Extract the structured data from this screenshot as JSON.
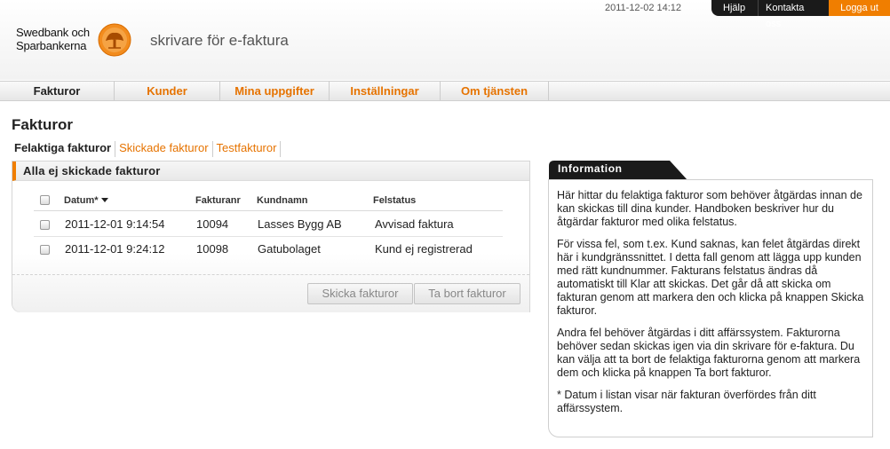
{
  "header": {
    "brand_line1": "Swedbank och",
    "brand_line2": "Sparbankerna",
    "app_title": "skrivare för e-faktura",
    "datetime": "2011-12-02 14:12",
    "links": {
      "help": "Hjälp",
      "contact": "Kontakta oss",
      "logout": "Logga ut"
    }
  },
  "nav": {
    "items": [
      {
        "label": "Fakturor",
        "active": true
      },
      {
        "label": "Kunder"
      },
      {
        "label": "Mina uppgifter"
      },
      {
        "label": "Inställningar"
      },
      {
        "label": "Om tjänsten"
      }
    ]
  },
  "page": {
    "title": "Fakturor",
    "subtabs": [
      "Felaktiga fakturor",
      "Skickade fakturor",
      "Testfakturor"
    ]
  },
  "invoices": {
    "panel_title": "Alla ej skickade fakturor",
    "columns": {
      "date": "Datum*",
      "number": "Fakturanr",
      "customer": "Kundnamn",
      "status": "Felstatus"
    },
    "rows": [
      {
        "date": "2011-12-01 9:14:54",
        "number": "10094",
        "customer": "Lasses Bygg AB",
        "status": "Avvisad faktura"
      },
      {
        "date": "2011-12-01 9:24:12",
        "number": "10098",
        "customer": "Gatubolaget",
        "status": "Kund ej registrerad"
      }
    ],
    "buttons": {
      "send": "Skicka fakturor",
      "delete": "Ta bort fakturor"
    }
  },
  "info": {
    "title": "Information",
    "paragraphs": [
      "Här hittar du felaktiga fakturor som behöver åtgärdas innan de kan skickas till dina kunder. Handboken beskriver hur du åtgärdar fakturor med olika felstatus.",
      "För vissa fel, som t.ex. Kund saknas, kan felet åtgärdas direkt här i kundgränssnittet. I detta fall genom att lägga upp kunden med rätt kundnummer. Fakturans felstatus ändras då automatiskt till Klar att skickas. Det går då att skicka om fakturan genom att markera den och klicka på knappen Skicka fakturor.",
      "Andra fel behöver åtgärdas i ditt affärssystem. Fakturorna behöver sedan skickas igen via din skrivare för e-faktura. Du kan välja att ta bort de felaktiga fakturorna genom att markera dem och klicka på knappen Ta bort fakturor.",
      "* Datum i listan visar när fakturan överfördes från ditt affärssystem."
    ]
  },
  "colors": {
    "accent": "#f07e00",
    "dark": "#1a1a1a"
  }
}
